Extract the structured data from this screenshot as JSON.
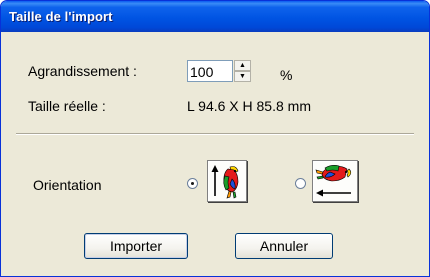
{
  "window": {
    "title": "Taille de l'import"
  },
  "zoom": {
    "label": "Agrandissement :",
    "value": "100",
    "unit": "%"
  },
  "size": {
    "label": "Taille réelle :",
    "value": "L 94.6 X H 85.8 mm"
  },
  "orientation": {
    "label": "Orientation",
    "options": [
      {
        "icon": "parrot-upright-arrow-up-icon",
        "selected": true
      },
      {
        "icon": "parrot-rotated-arrow-left-icon",
        "selected": false
      }
    ]
  },
  "buttons": {
    "import": "Importer",
    "cancel": "Annuler"
  }
}
